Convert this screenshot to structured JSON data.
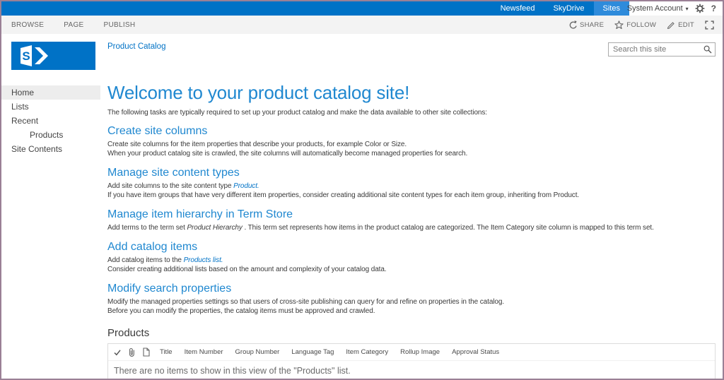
{
  "colors": {
    "suite_bar": "#0072c6",
    "suite_active": "#2e8bdb",
    "accent": "#0072c6",
    "heading_blue": "#2088d0",
    "window_border": "#9a8096"
  },
  "suite_bar": {
    "nav": [
      {
        "label": "Newsfeed",
        "active": false
      },
      {
        "label": "SkyDrive",
        "active": false
      },
      {
        "label": "Sites",
        "active": true
      }
    ],
    "account": {
      "label": "System Account",
      "caret": "▾"
    },
    "icons": [
      "gear-icon",
      "help-icon"
    ],
    "help_label": "?"
  },
  "ribbon": {
    "tabs": [
      "BROWSE",
      "PAGE",
      "PUBLISH"
    ],
    "actions": [
      {
        "label": "SHARE",
        "icon": "share-icon"
      },
      {
        "label": "FOLLOW",
        "icon": "star-icon"
      },
      {
        "label": "EDIT",
        "icon": "pencil-icon"
      }
    ]
  },
  "sidebar": {
    "logo_letter": "S",
    "items": [
      {
        "label": "Home",
        "active": true,
        "indent": false
      },
      {
        "label": "Lists",
        "active": false,
        "indent": false
      },
      {
        "label": "Recent",
        "active": false,
        "indent": false
      },
      {
        "label": "Products",
        "active": false,
        "indent": true
      },
      {
        "label": "Site Contents",
        "active": false,
        "indent": false
      }
    ]
  },
  "header": {
    "breadcrumb": "Product Catalog",
    "search_placeholder": "Search this site"
  },
  "main": {
    "title": "Welcome to your product catalog site!",
    "intro": "The following tasks are typically required to set up your product catalog and make the data available to other site collections:",
    "sections": [
      {
        "heading": "Create site columns",
        "lines": [
          [
            {
              "t": "Create site columns for the item properties that describe your products, for example Color or Size."
            }
          ],
          [
            {
              "t": "When your product catalog site is crawled, the site columns will automatically become managed properties for search."
            }
          ]
        ]
      },
      {
        "heading": "Manage site content types",
        "lines": [
          [
            {
              "t": "Add site columns to the site content type "
            },
            {
              "t": "Product.",
              "s": "link"
            }
          ],
          [
            {
              "t": "If you have item groups that have very different item properties, consider creating additional site content types for each item group, inheriting from Product."
            }
          ]
        ]
      },
      {
        "heading": "Manage item hierarchy in Term Store",
        "lines": [
          [
            {
              "t": "Add terms to the term set "
            },
            {
              "t": "Product Hierarchy",
              "s": "em"
            },
            {
              "t": " . This term set represents how items in the product catalog are categorized. The Item Category site column is mapped to this term set."
            }
          ]
        ]
      },
      {
        "heading": "Add catalog items",
        "lines": [
          [
            {
              "t": "Add catalog items to the "
            },
            {
              "t": "Products list.",
              "s": "link"
            }
          ],
          [
            {
              "t": "Consider creating additional lists based on the amount and complexity of your catalog data."
            }
          ]
        ]
      },
      {
        "heading": "Modify search properties",
        "lines": [
          [
            {
              "t": "Modify the managed properties settings so that users of cross-site publishing can query for and refine on properties in the catalog."
            }
          ],
          [
            {
              "t": "Before you can modify the properties, the catalog items must be approved and crawled."
            }
          ]
        ]
      }
    ]
  },
  "products": {
    "title": "Products",
    "header_icons": [
      "check-icon",
      "paperclip-icon",
      "document-icon"
    ],
    "columns": [
      "Title",
      "Item Number",
      "Group Number",
      "Language Tag",
      "Item Category",
      "Rollup Image",
      "Approval Status"
    ],
    "empty_message": "There are no items to show in this view of the \"Products\" list."
  }
}
